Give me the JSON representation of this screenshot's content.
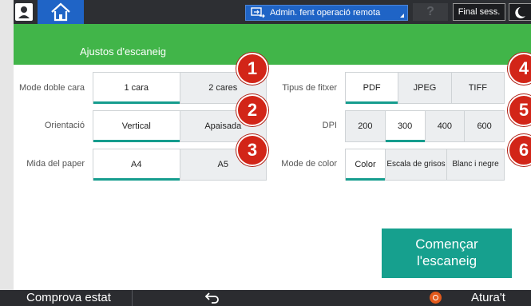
{
  "topbar": {
    "admin_label": "Admin. fent operació remota",
    "help_label": "?",
    "end_session_label": "Final sess."
  },
  "header": {
    "title": "Ajustos d'escaneig"
  },
  "settings": {
    "duplex": {
      "label": "Mode doble cara",
      "options": [
        "1 cara",
        "2 cares"
      ],
      "selected": "1 cara"
    },
    "orientation": {
      "label": "Orientació",
      "options": [
        "Vertical",
        "Apaisada"
      ],
      "selected": "Vertical"
    },
    "paper_size": {
      "label": "Mida del paper",
      "options": [
        "A4",
        "A5"
      ],
      "selected": "A4"
    },
    "file_type": {
      "label": "Tipus de fitxer",
      "options": [
        "PDF",
        "JPEG",
        "TIFF"
      ],
      "selected": "PDF"
    },
    "dpi": {
      "label": "DPI",
      "options": [
        "200",
        "300",
        "400",
        "600"
      ],
      "selected": "300"
    },
    "color_mode": {
      "label": "Mode de color",
      "options": [
        "Color",
        "Escala de grisos",
        "Blanc i negre"
      ],
      "selected": "Color"
    }
  },
  "badges": [
    "1",
    "2",
    "3",
    "4",
    "5",
    "6"
  ],
  "start_button": {
    "line1": "Començar",
    "line2": "l'escaneig"
  },
  "bottombar": {
    "check_status": "Comprova estat",
    "stop": "Atura't"
  },
  "colors": {
    "green_header": "#41b549",
    "teal": "#16a08e",
    "topbar": "#2d2f33",
    "blue": "#1f64c6",
    "badge_red": "#d22518"
  }
}
